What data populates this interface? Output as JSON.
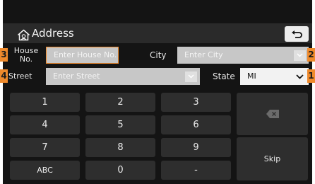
{
  "header": {
    "title": "Address",
    "back_icon": "back-arrow-icon",
    "home_icon": "home-icon"
  },
  "form": {
    "house": {
      "label_line1": "House",
      "label_line2": "No.",
      "placeholder": "Enter House No.",
      "callout": "3"
    },
    "city": {
      "label": "City",
      "placeholder": "Enter City",
      "callout": "2"
    },
    "street": {
      "label": "Street",
      "placeholder": "Enter Street",
      "callout": "4"
    },
    "state": {
      "label": "State",
      "value": "MI",
      "callout": "1"
    }
  },
  "keypad": {
    "keys": [
      "1",
      "2",
      "3",
      "4",
      "5",
      "6",
      "7",
      "8",
      "9",
      "ABC",
      "0",
      "-"
    ],
    "backspace_icon": "backspace-icon",
    "skip_label": "Skip"
  },
  "colors": {
    "accent_callout": "#ef8a2c",
    "panel_bg": "#141414",
    "field_bg": "#c7c7c7",
    "key_bg": "#2e2e2e"
  }
}
